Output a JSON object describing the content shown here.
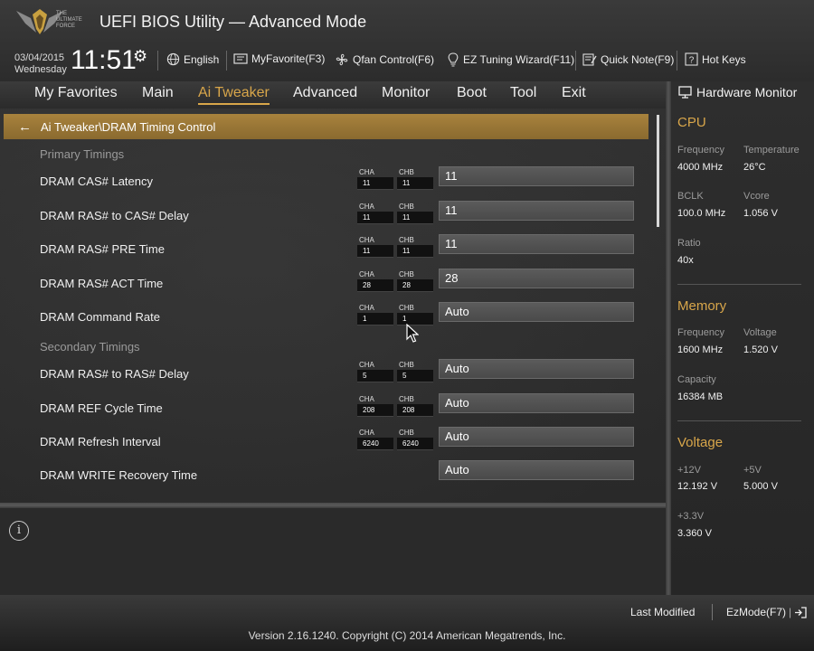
{
  "header": {
    "logo_text": "THE ULTIMATE FORCE",
    "title": "UEFI BIOS Utility — Advanced Mode",
    "date": "03/04/2015",
    "day": "Wednesday",
    "time": "11:51",
    "buttons": [
      {
        "icon": "globe-icon",
        "label": "English"
      },
      {
        "icon": "favorite-icon",
        "label": "MyFavorite(F3)"
      },
      {
        "icon": "fan-icon",
        "label": "Qfan Control(F6)"
      },
      {
        "icon": "bulb-icon",
        "label": "EZ Tuning Wizard(F11)"
      },
      {
        "icon": "note-icon",
        "label": "Quick Note(F9)"
      },
      {
        "icon": "help-icon",
        "label": "Hot Keys"
      }
    ]
  },
  "menu": {
    "items": [
      "My Favorites",
      "Main",
      "Ai Tweaker",
      "Advanced",
      "Monitor",
      "Boot",
      "Tool",
      "Exit"
    ],
    "active": "Ai Tweaker"
  },
  "breadcrumb": "Ai Tweaker\\DRAM Timing Control",
  "sections": {
    "primary": "Primary Timings",
    "secondary": "Secondary Timings"
  },
  "channel_labels": {
    "a": "CHA",
    "b": "CHB"
  },
  "rows": [
    {
      "label": "DRAM CAS# Latency",
      "cha": "11",
      "chb": "11",
      "value": "11"
    },
    {
      "label": "DRAM RAS# to CAS# Delay",
      "cha": "11",
      "chb": "11",
      "value": "11"
    },
    {
      "label": "DRAM RAS# PRE Time",
      "cha": "11",
      "chb": "11",
      "value": "11"
    },
    {
      "label": "DRAM RAS# ACT Time",
      "cha": "28",
      "chb": "28",
      "value": "28"
    },
    {
      "label": "DRAM Command Rate",
      "cha": "1",
      "chb": "1",
      "value": "Auto"
    },
    {
      "label": "DRAM RAS# to RAS# Delay",
      "cha": "5",
      "chb": "5",
      "value": "Auto"
    },
    {
      "label": "DRAM REF Cycle Time",
      "cha": "208",
      "chb": "208",
      "value": "Auto"
    },
    {
      "label": "DRAM Refresh Interval",
      "cha": "6240",
      "chb": "6240",
      "value": "Auto"
    },
    {
      "label": "DRAM WRITE Recovery Time",
      "cha": "",
      "chb": "",
      "value": "Auto"
    }
  ],
  "hardware_monitor": {
    "title": "Hardware Monitor",
    "cpu": {
      "heading": "CPU",
      "frequency_label": "Frequency",
      "frequency": "4000 MHz",
      "temperature_label": "Temperature",
      "temperature": "26°C",
      "bclk_label": "BCLK",
      "bclk": "100.0 MHz",
      "vcore_label": "Vcore",
      "vcore": "1.056 V",
      "ratio_label": "Ratio",
      "ratio": "40x"
    },
    "memory": {
      "heading": "Memory",
      "frequency_label": "Frequency",
      "frequency": "1600 MHz",
      "voltage_label": "Voltage",
      "voltage": "1.520 V",
      "capacity_label": "Capacity",
      "capacity": "16384 MB"
    },
    "voltage": {
      "heading": "Voltage",
      "v12_label": "+12V",
      "v12": "12.192 V",
      "v5_label": "+5V",
      "v5": "5.000 V",
      "v33_label": "+3.3V",
      "v33": "3.360 V"
    }
  },
  "footer": {
    "last_modified": "Last Modified",
    "ezmode": "EzMode(F7)",
    "version": "Version 2.16.1240. Copyright (C) 2014 American Megatrends, Inc."
  },
  "colors": {
    "accent": "#d8a64a",
    "breadcrumb": "#9a7636"
  }
}
